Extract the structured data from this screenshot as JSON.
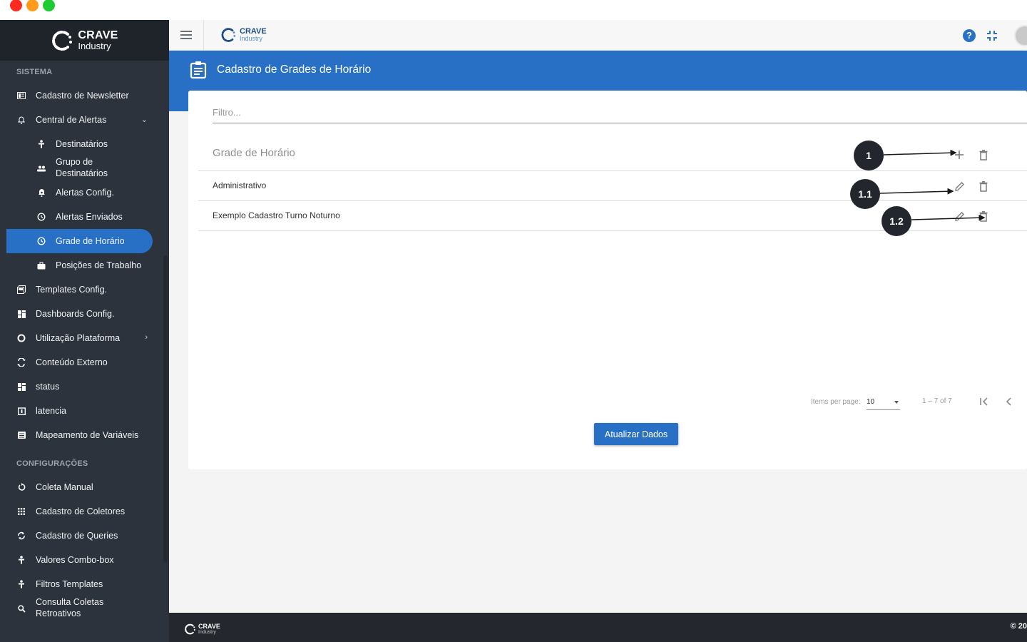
{
  "brand": {
    "name": "CRAVE",
    "sub": "Industry"
  },
  "sidebar": {
    "sections": [
      {
        "title": "SISTEMA",
        "items": [
          {
            "label": "Cadastro de Newsletter",
            "icon": "newspaper-icon"
          },
          {
            "label": "Central de Alertas",
            "icon": "bell-icon",
            "chevron": "down"
          },
          {
            "label": "Destinatários",
            "icon": "person-icon",
            "sub": true
          },
          {
            "label": "Grupo de Destinatários",
            "icon": "group-icon",
            "sub": true
          },
          {
            "label": "Alertas Config.",
            "icon": "bell-config-icon",
            "sub": true
          },
          {
            "label": "Alertas Enviados",
            "icon": "history-icon",
            "sub": true
          },
          {
            "label": "Grade de Horário",
            "icon": "clock-icon",
            "sub": true,
            "active": true
          },
          {
            "label": "Posições de Trabalho",
            "icon": "briefcase-icon",
            "sub": true
          },
          {
            "label": "Templates Config.",
            "icon": "template-icon"
          },
          {
            "label": "Dashboards Config.",
            "icon": "dashboard-icon"
          },
          {
            "label": "Utilização Plataforma",
            "icon": "circle-icon",
            "chevron": "right"
          },
          {
            "label": "Conteúdo Externo",
            "icon": "external-icon"
          },
          {
            "label": "status",
            "icon": "grid-icon"
          },
          {
            "label": "latencia",
            "icon": "calendar-icon"
          },
          {
            "label": "Mapeamento de Variáveis",
            "icon": "list-icon"
          }
        ]
      },
      {
        "title": "CONFIGURAÇÕES",
        "items": [
          {
            "label": "Coleta Manual",
            "icon": "refresh-icon"
          },
          {
            "label": "Cadastro de Coletores",
            "icon": "apps-icon"
          },
          {
            "label": "Cadastro de Queries",
            "icon": "sync-icon"
          },
          {
            "label": "Valores Combo-box",
            "icon": "person-icon"
          },
          {
            "label": "Filtros Templates",
            "icon": "person-icon"
          },
          {
            "label": "Consulta Coletas Retroativos",
            "icon": "search-icon"
          }
        ]
      }
    ]
  },
  "header": {
    "title": "Cadastro de Grades de Horário"
  },
  "filter": {
    "placeholder": "Filtro..."
  },
  "table": {
    "column": "Grade de Horário",
    "rows": [
      "Administrativo",
      "Exemplo Cadastro Turno Noturno"
    ]
  },
  "paginator": {
    "items_per_page_label": "Items per page:",
    "items_per_page": "10",
    "range": "1 – 7 of 7"
  },
  "actions": {
    "update": "Atualizar Dados"
  },
  "callouts": [
    "1",
    "1.1",
    "1.2"
  ],
  "footer": {
    "copyright": "© 20"
  },
  "colors": {
    "primary": "#2870c5",
    "sidebar": "#2c333c",
    "footer": "#24282e"
  }
}
